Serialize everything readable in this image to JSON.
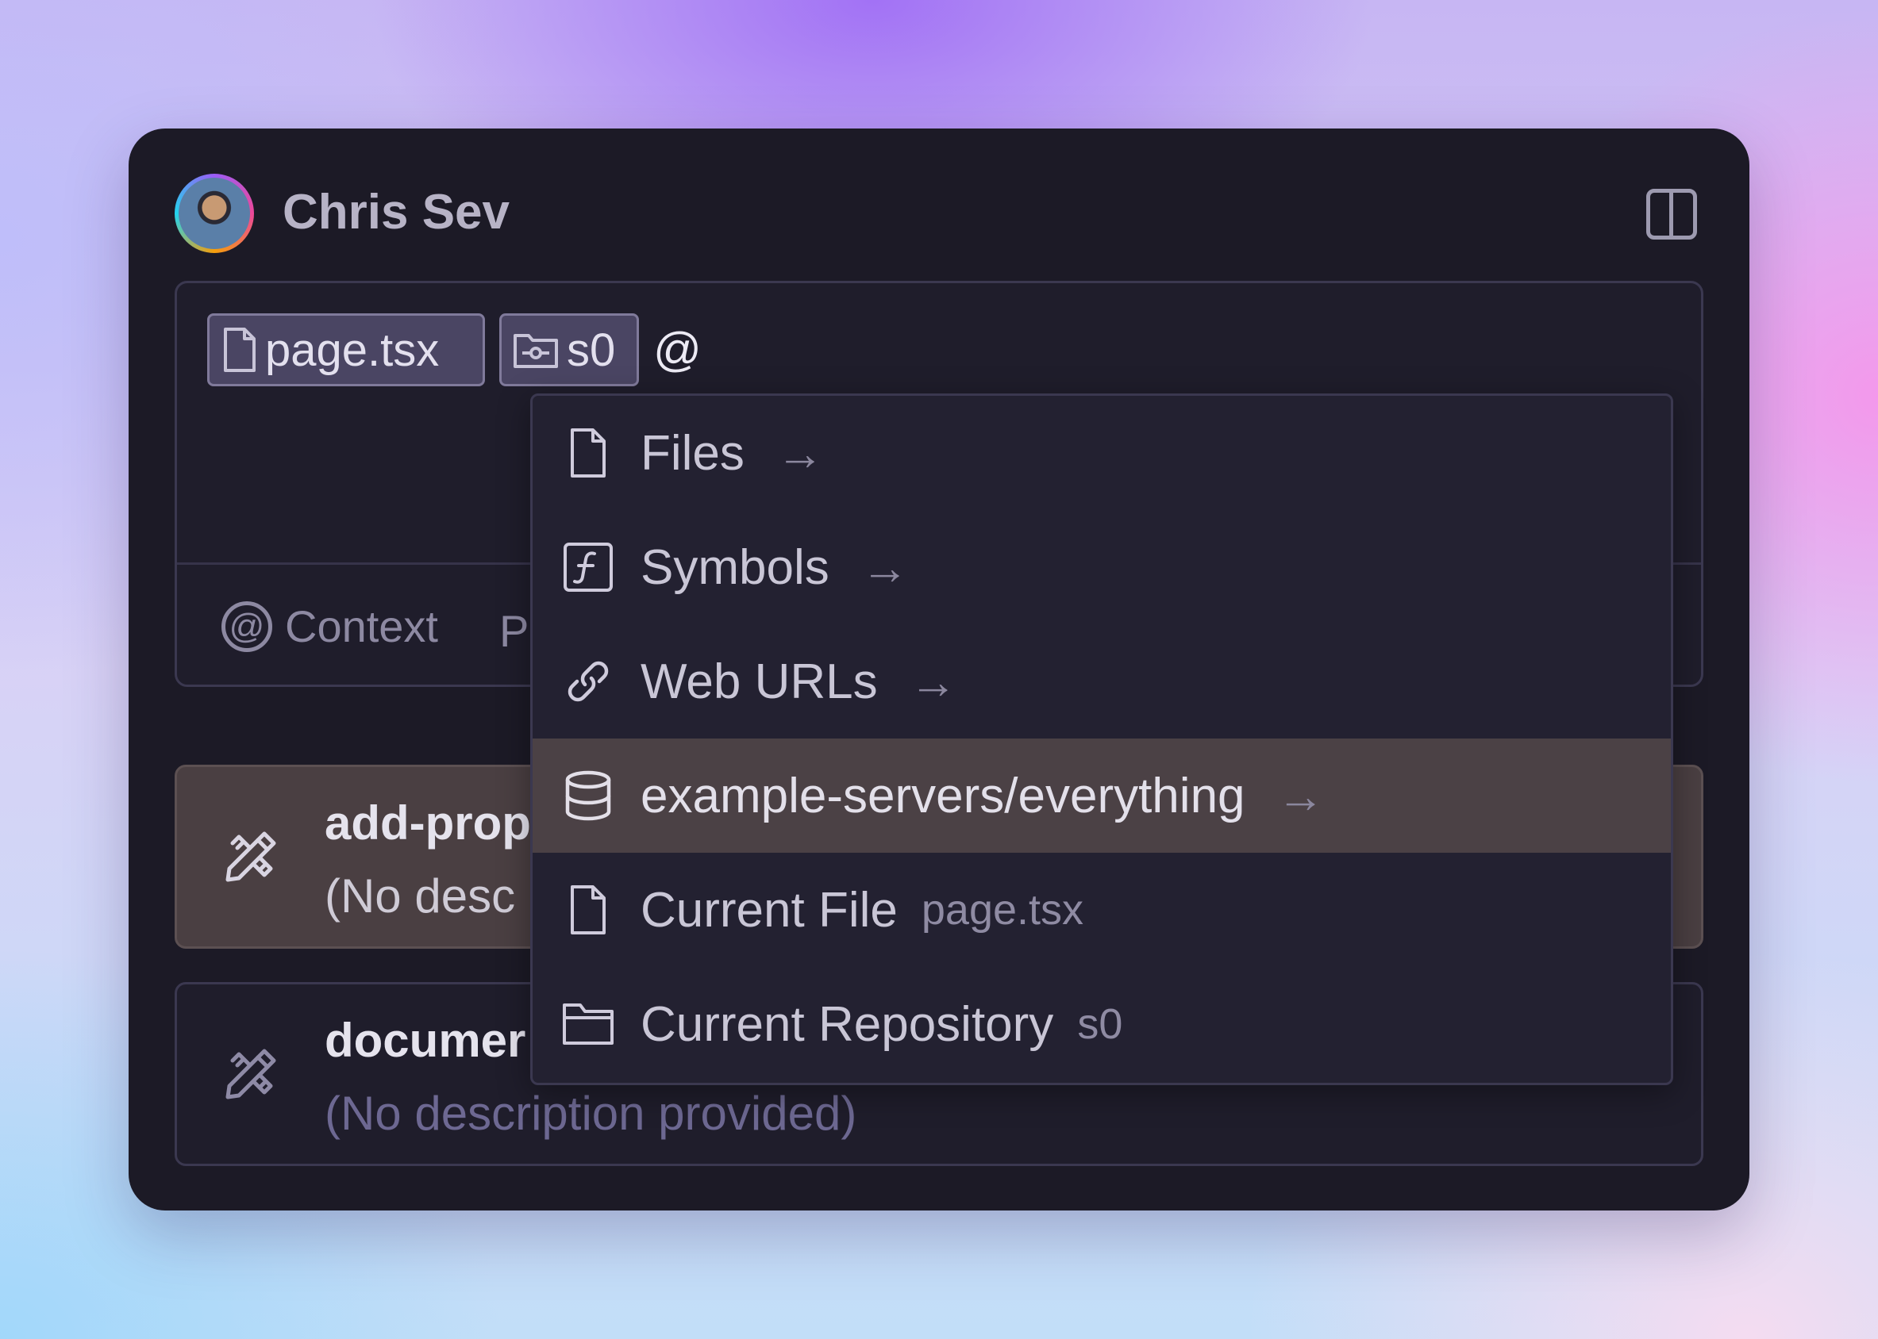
{
  "header": {
    "user_name": "Chris Sev"
  },
  "composer": {
    "chips": [
      {
        "label": "page.tsx",
        "icon": "file-icon"
      },
      {
        "label": "s0",
        "icon": "repository-folder-icon"
      }
    ],
    "typed_text": "@",
    "toolbar": {
      "context_label": "Context",
      "prompts_label_visible": "P"
    }
  },
  "prompts": [
    {
      "title": "add-prop",
      "description": "(No desc",
      "icon": "pencil-ruler-icon",
      "highlighted": true
    },
    {
      "title": "documer",
      "description": "(No description provided)",
      "icon": "pencil-ruler-icon",
      "highlighted": false
    }
  ],
  "dropdown": {
    "items": [
      {
        "label": "Files",
        "icon": "file-icon",
        "arrow": "→"
      },
      {
        "label": "Symbols",
        "icon": "function-icon",
        "arrow": "→"
      },
      {
        "label": "Web URLs",
        "icon": "link-icon",
        "arrow": "→"
      },
      {
        "label": "example-servers/everything",
        "icon": "database-icon",
        "arrow": "→",
        "selected": true
      },
      {
        "label": "Current File",
        "icon": "file-icon",
        "hint": "page.tsx"
      },
      {
        "label": "Current Repository",
        "icon": "folder-icon",
        "hint": "s0"
      }
    ]
  },
  "colors": {
    "panel_bg": "#1c1a26",
    "selected_row": "#4b4145",
    "chip_bg": "#4a4563"
  }
}
